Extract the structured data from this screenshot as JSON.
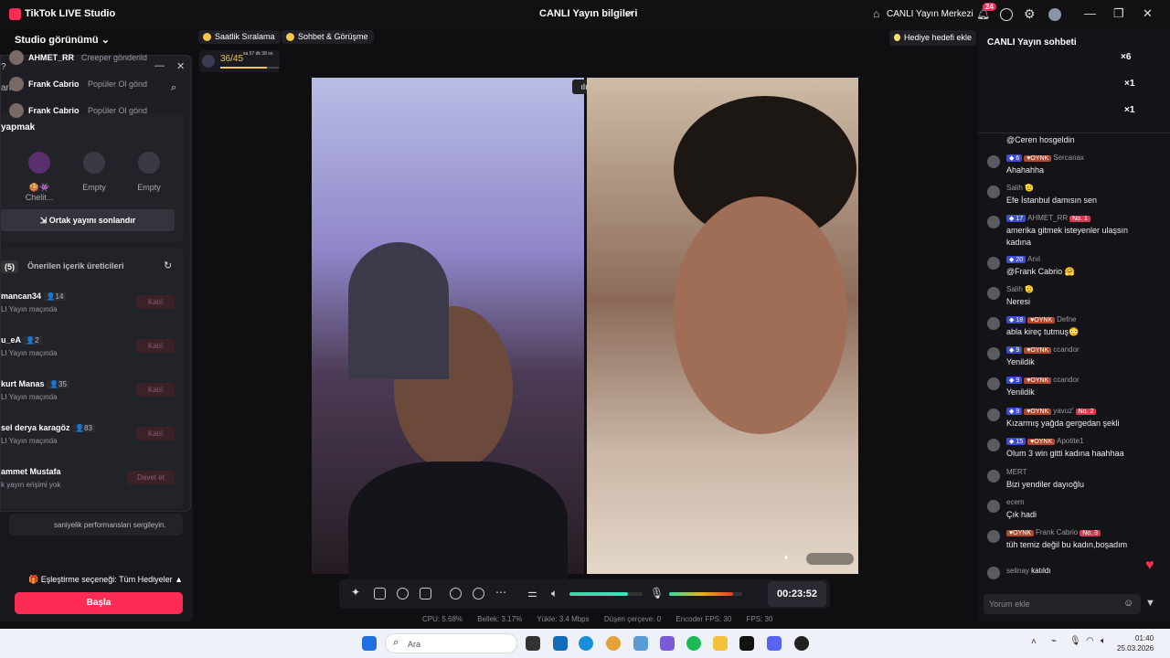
{
  "titlebar": {
    "app_name": "TikTok LIVE Studio",
    "live_info": "CANLI Yayın bilgileri",
    "live_center": "CANLI Yayın Merkezi",
    "notif_count": "24"
  },
  "left": {
    "studio_view": "Studio görünümü",
    "search_placeholder": "arlar",
    "section_title": "yapmak",
    "slots": [
      {
        "label": "🍪👾Chelit..."
      },
      {
        "label": "Empty"
      },
      {
        "label": "Empty"
      }
    ],
    "end_cohost": "Ortak yayını sonlandır",
    "tab_count": "(5)",
    "recommended": "Önerilen içerik üreticileri",
    "creators": [
      {
        "name": "mancan34",
        "viewers": "14",
        "status": "LI Yayın maçında",
        "action": "Katıl"
      },
      {
        "name": "u_eA",
        "viewers": "2",
        "status": "LI Yayın maçında",
        "action": "Katıl"
      },
      {
        "name": "kurt Manas",
        "viewers": "35",
        "status": "LI Yayın maçında",
        "action": "Katıl"
      },
      {
        "name": "sel derya karagöz",
        "viewers": "83",
        "status": "LI Yayın maçında",
        "action": "Katıl"
      },
      {
        "name": "ammet Mustafa",
        "viewers": "",
        "status": "k yayın erişimi yok",
        "action": "Davet et"
      }
    ],
    "perf_text": "saniyelik performansları sergileyin.",
    "match_option": "🎁 Eşleştirme seçeneği: Tüm Hediyeler ▲",
    "start": "Başla"
  },
  "top": {
    "ranking": "Saatlik Sıralama",
    "chat_meet": "Sohbet & Görüşme",
    "gift_goal": "Hediye hedefi ekle",
    "progress": "36/45",
    "progress_fraction": 0.8,
    "progress_time": "sa 57 dk 38 sn"
  },
  "stream": {
    "timer": "00:23:52"
  },
  "stats": {
    "cpu": "CPU:  5.68%",
    "mem": "Bellek:  3.17%",
    "upload": "Yükle:  3.4 Mbps",
    "dropped": "Düşen çerçeve:  0",
    "encoder": "Encoder FPS:  30",
    "fps": "FPS:  30"
  },
  "chat": {
    "title": "CANLI Yayın sohbeti",
    "gifts": [
      {
        "user": "AHMET_RR",
        "text": "Creeper gönderild",
        "count": "×6"
      },
      {
        "user": "Frank Cabrio",
        "text": "Popüler Ol gönd",
        "count": "×1"
      },
      {
        "user": "Frank Cabrio",
        "text": "Popüler Ol gönd",
        "count": "×1"
      }
    ],
    "messages": [
      {
        "meta": "",
        "text": "@Ceren hosgeldin"
      },
      {
        "level": "6",
        "oynk": "OYNK",
        "user": "Sercanax",
        "text": "Ahahahha"
      },
      {
        "user": "Salih 🫡",
        "text": "Efe İstanbul damısın sen"
      },
      {
        "level": "17",
        "user": "AHMET_RR",
        "no": "No. 1",
        "text": "amerika gitmek isteyenler ulaşsın"
      },
      {
        "text2": "kadına"
      },
      {
        "level": "20",
        "user": "Anıl",
        "text": "@Frank Cabrio 🤗"
      },
      {
        "user": "Salih 🫡",
        "text": "Neresi"
      },
      {
        "level": "18",
        "oynk": "OYNK",
        "user": "Defne",
        "text": "abla kireç tutmuş😳"
      },
      {
        "level": "9",
        "oynk": "OYNK",
        "user": "ccandor",
        "text": "Yenildik"
      },
      {
        "level": "9",
        "oynk": "OYNK",
        "user": "ccandor",
        "text": "Yenildik"
      },
      {
        "level": "9",
        "oynk": "OYNK",
        "user": "yavuz'",
        "no": "No. 2",
        "text": "Kızarmış yağda gergedan şekli"
      },
      {
        "level": "15",
        "oynk": "OYNK",
        "user": "Apotite1",
        "text": "Olum 3 win gitti kadına haahhaa"
      },
      {
        "user": "MERT",
        "text": "Bizi yendiler dayıoğlu"
      },
      {
        "user": "ecem",
        "text": "Çık hadi"
      },
      {
        "oynk": "OYNK",
        "user": "Frank Cabrio",
        "no": "No. 3",
        "text": "tüh temiz değil bu kadın,boşadım"
      },
      {
        "join_user": "selinay",
        "join_text": "katıldı"
      }
    ],
    "input_placeholder": "Yorum ekle"
  },
  "taskbar": {
    "search": "Ara",
    "time": "01:40",
    "date": "25.03.2026"
  }
}
